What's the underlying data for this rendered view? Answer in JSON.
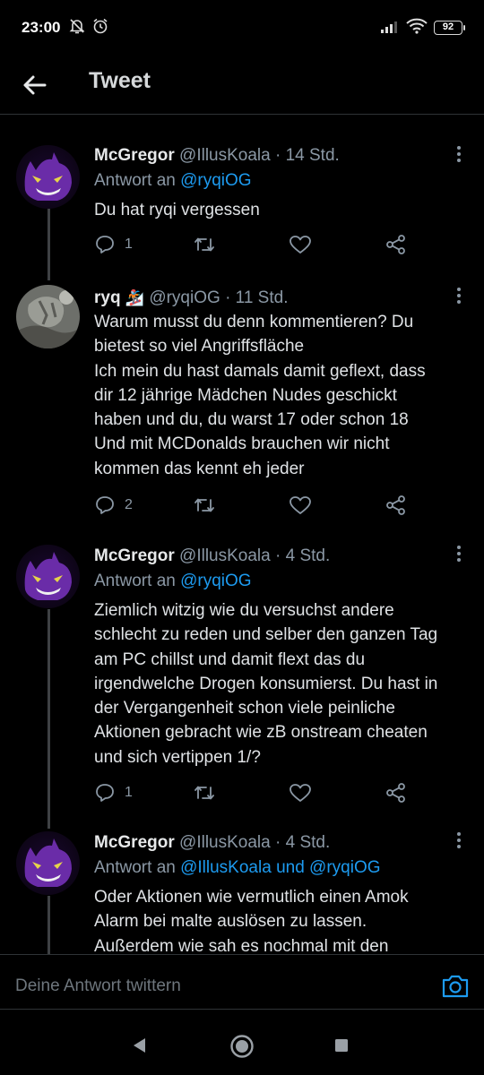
{
  "status_bar": {
    "time": "23:00",
    "battery": "92",
    "icons": [
      "mute-bell-icon",
      "alarm-icon",
      "signal-icon",
      "wifi-icon",
      "battery-icon"
    ]
  },
  "header": {
    "title": "Tweet",
    "back_icon": "arrow-left-icon"
  },
  "tweets": [
    {
      "name": "McGregor",
      "handle": "@IllusKoala",
      "dot": "·",
      "time": "14 Std.",
      "reply_prefix": "Antwort an",
      "reply_to_1": "@ryqiOG",
      "lines": [
        "Du hat ryqi vergessen"
      ],
      "reply_count": "1"
    },
    {
      "name": "ryq",
      "name_emoji": "🏂",
      "handle": "@ryqiOG",
      "dot": "·",
      "time": "11 Std.",
      "lines": [
        "Warum musst du denn kommentieren? Du",
        "bietest so viel Angriffsfläche",
        "Ich mein du hast damals damit geflext, dass",
        "dir 12 jährige Mädchen Nudes geschickt",
        "haben und du, du warst 17 oder schon 18",
        "Und mit MCDonalds brauchen wir nicht",
        "kommen das kennt eh jeder"
      ],
      "reply_count": "2"
    },
    {
      "name": "McGregor",
      "handle": "@IllusKoala",
      "dot": "·",
      "time": "4 Std.",
      "reply_prefix": "Antwort an",
      "reply_to_1": "@ryqiOG",
      "lines": [
        "Ziemlich witzig wie du versuchst andere",
        "schlecht zu reden und selber den ganzen Tag",
        "am PC chillst und damit flext das du",
        "irgendwelche Drogen konsumierst. Du hast in",
        "der Vergangenheit schon viele peinliche",
        "Aktionen gebracht wie zB onstream cheaten",
        "und sich vertippen 1/?"
      ],
      "reply_count": "1"
    },
    {
      "name": "McGregor",
      "handle": "@IllusKoala",
      "dot": "·",
      "time": "4 Std.",
      "reply_prefix": "Antwort an",
      "reply_to_1": "@IllusKoala",
      "reply_and": "und",
      "reply_to_2": "@ryqiOG",
      "lines": [
        "Oder Aktionen wie vermutlich einen  Amok",
        "Alarm bei malte auslösen zu lassen.",
        "Außerdem wie sah es nochmal mit den"
      ]
    }
  ],
  "composer": {
    "placeholder": "Deine Antwort twittern",
    "camera_icon": "camera-icon"
  },
  "nav": {
    "icons": [
      "back-triangle-icon",
      "home-circle-icon",
      "recents-square-icon"
    ]
  },
  "colors": {
    "background": "#000000",
    "link": "#1d9bf0",
    "muted": "#8b98a5",
    "divider": "#2f3336"
  }
}
